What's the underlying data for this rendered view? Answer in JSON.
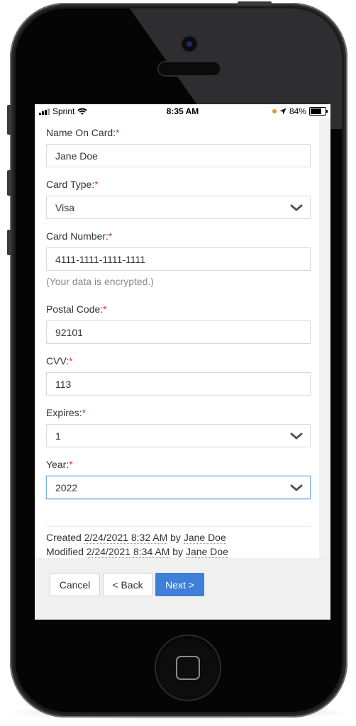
{
  "status_bar": {
    "carrier": "Sprint",
    "time": "8:35 AM",
    "battery": "84%",
    "battery_level": 0.84
  },
  "form": {
    "name_on_card": {
      "label": "Name On Card:",
      "required": "*",
      "value": "Jane Doe"
    },
    "card_type": {
      "label": "Card Type:",
      "required": "*",
      "value": "Visa"
    },
    "card_number": {
      "label": "Card Number:",
      "required": "*",
      "value": "4111-1111-1111-1111",
      "hint": "(Your data is encrypted.)"
    },
    "postal_code": {
      "label": "Postal Code:",
      "required": "*",
      "value": "92101"
    },
    "cvv": {
      "label": "CVV:",
      "required": "*",
      "value": "113"
    },
    "expires": {
      "label": "Expires:",
      "required": "*",
      "value": "1"
    },
    "year": {
      "label": "Year:",
      "required": "*",
      "value": "2022"
    }
  },
  "meta": {
    "created_prefix": "Created",
    "created_date": "2/24/2021 8:32 AM",
    "created_by_word": "by",
    "created_by": "Jane Doe",
    "modified_prefix": "Modified",
    "modified_date": "2/24/2021 8:34 AM",
    "modified_by_word": "by",
    "modified_by": "Jane Doe"
  },
  "buttons": {
    "cancel": "Cancel",
    "back": "< Back",
    "next": "Next >"
  },
  "colors": {
    "primary": "#3f7fd9",
    "required": "#d03a2e",
    "focus_border": "#7fb0e8"
  },
  "icons": [
    "signal-icon",
    "wifi-icon",
    "location-arrow-icon",
    "battery-icon",
    "chevron-down-icon"
  ]
}
